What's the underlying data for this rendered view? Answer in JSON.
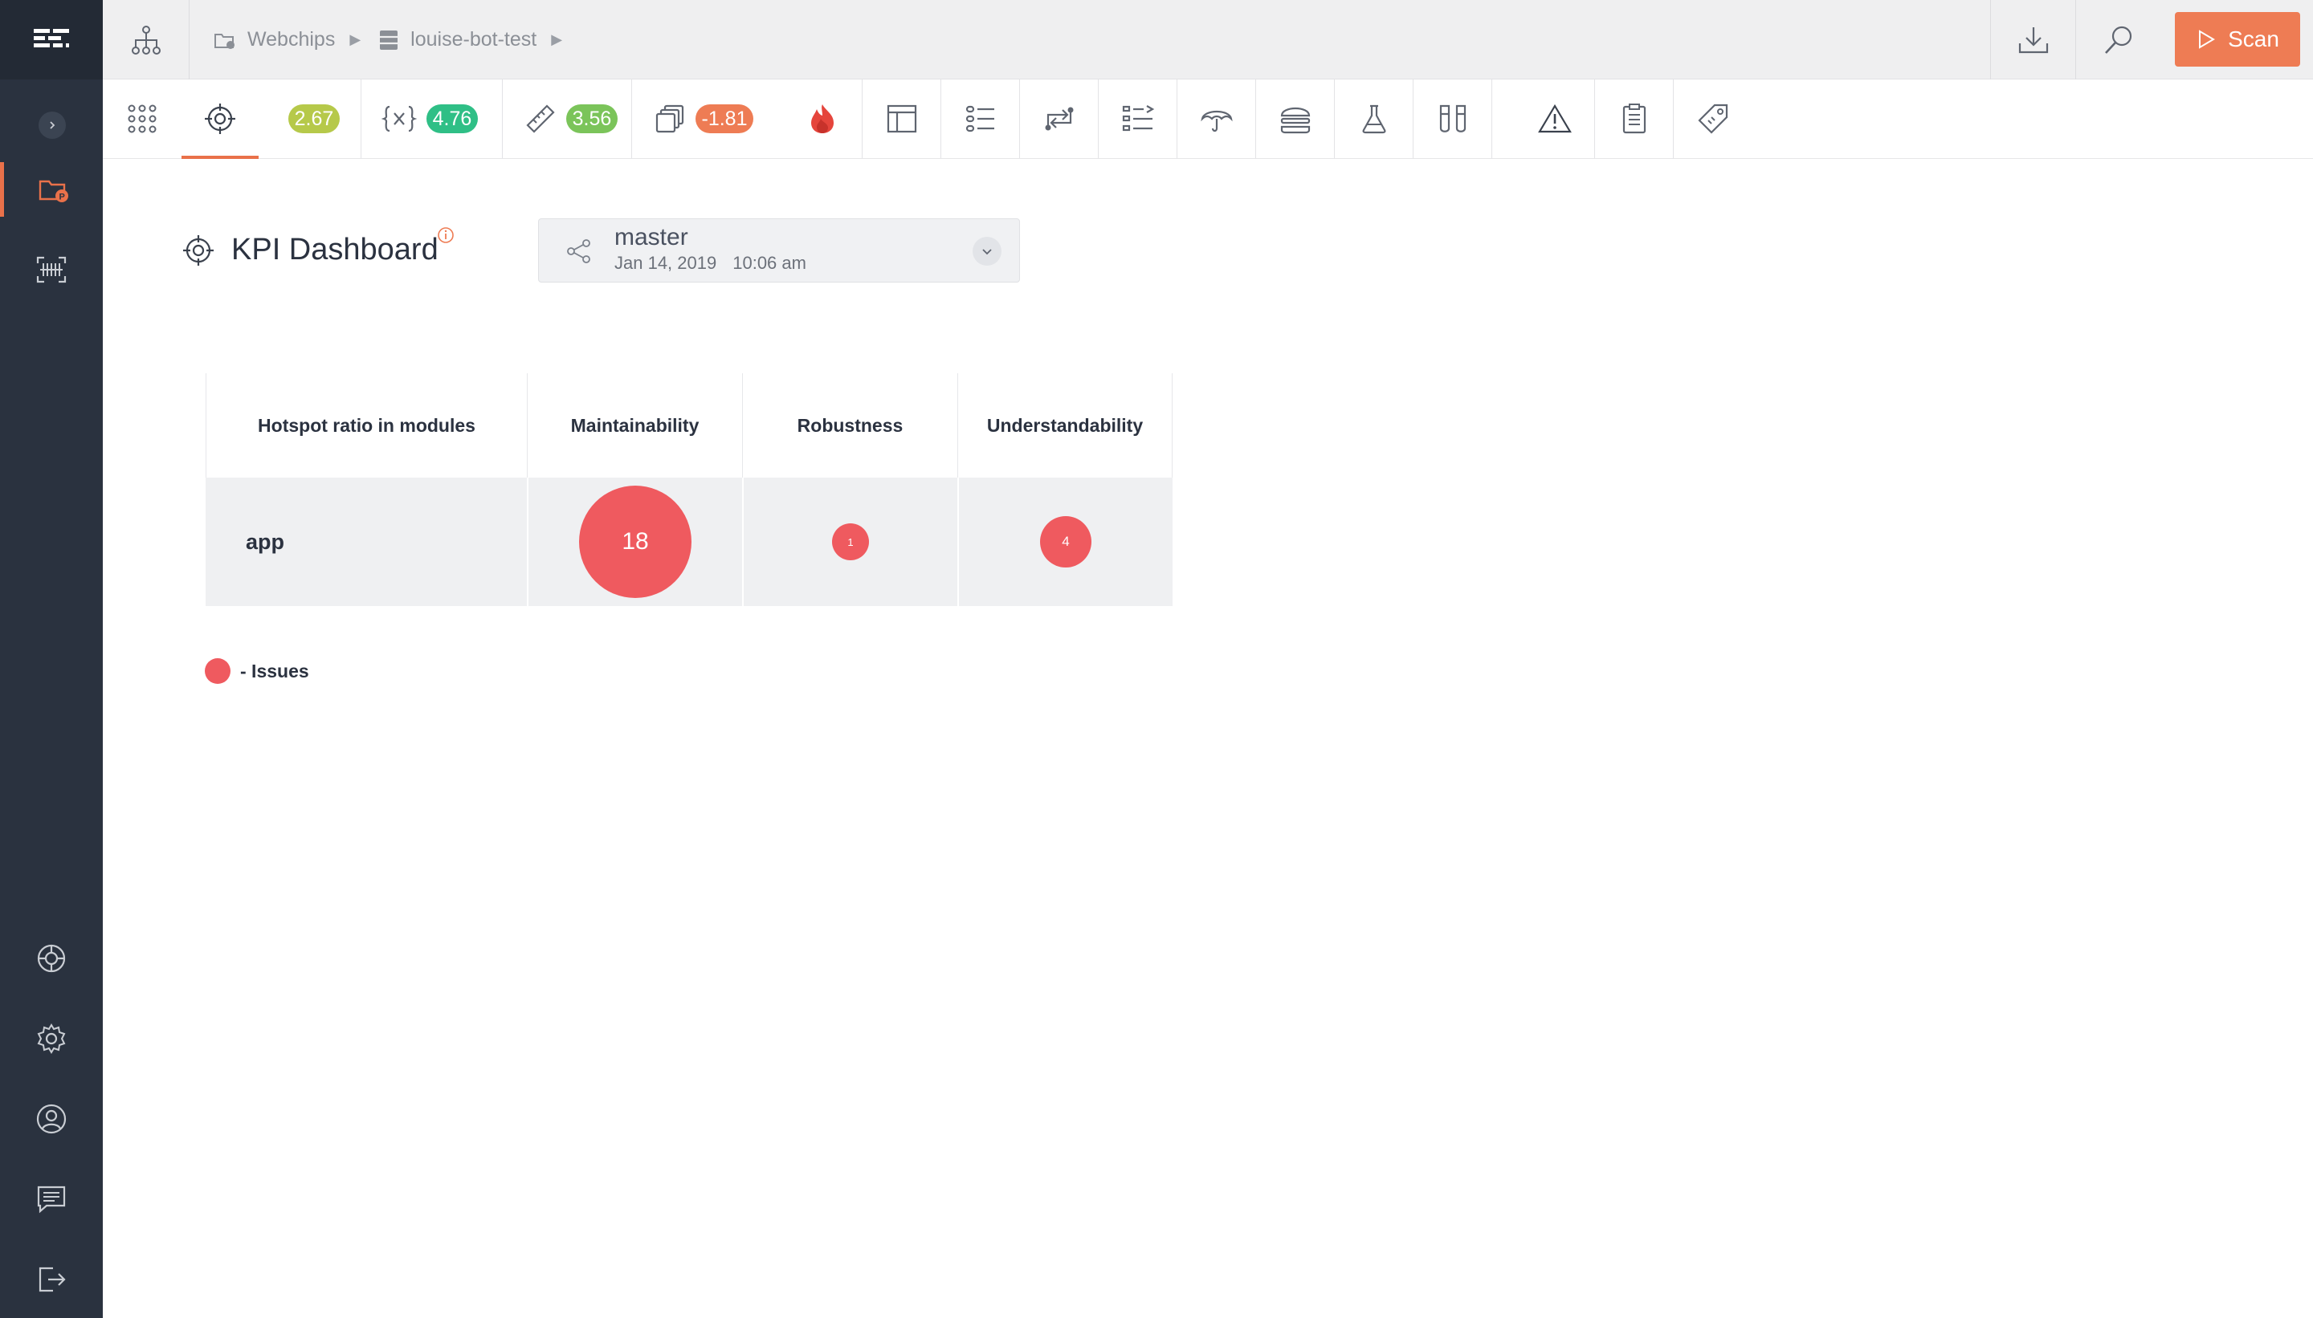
{
  "colors": {
    "accent": "#e9714a",
    "sidebar_bg": "#2a323f",
    "issue_red": "#ef5a5f",
    "badge_yellowgreen": "#b6c94a",
    "badge_green": "#2fbf86",
    "badge_lightgreen": "#7bc45a",
    "badge_orange": "#ee7c54"
  },
  "sidebar": {
    "logo": "codescene-logo-icon",
    "top_items": [
      "projects-icon",
      "scan-icon"
    ],
    "bottom_items": [
      "help-lifebuoy-icon",
      "settings-gear-icon",
      "user-profile-icon",
      "feedback-chat-icon",
      "logout-icon"
    ]
  },
  "breadcrumb": {
    "project": "Webchips",
    "repository": "louise-bot-test"
  },
  "header": {
    "scan_label": "Scan"
  },
  "toolbar": {
    "badges": {
      "code_health": "2.67",
      "functions": "4.76",
      "size": "3.56",
      "duplication": "-1.81"
    }
  },
  "page": {
    "title": "KPI Dashboard"
  },
  "branch": {
    "name": "master",
    "date": "Jan 14, 2019",
    "time": "10:06 am"
  },
  "table": {
    "headers": [
      "Hotspot ratio in modules",
      "Maintainability",
      "Robustness",
      "Understandability"
    ],
    "rows": [
      {
        "module": "app",
        "maintainability": "18",
        "robustness": "1",
        "understandability": "4"
      }
    ]
  },
  "legend": {
    "label": "- Issues"
  }
}
